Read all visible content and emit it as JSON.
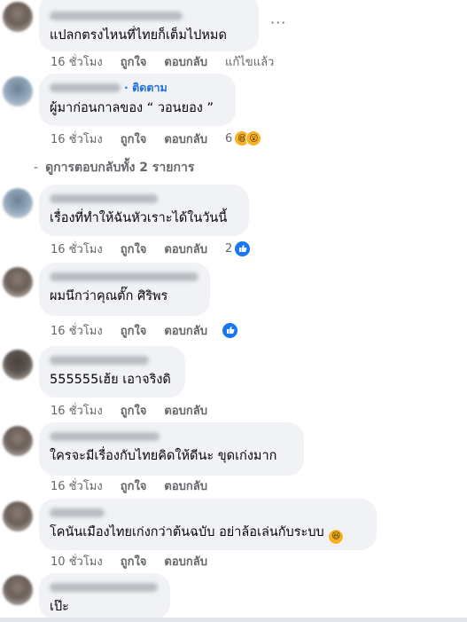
{
  "comments": [
    {
      "text": "แปลกตรงไหนที่ไทยก็เต็มไปหมด",
      "time": "16 ชั่วโมง",
      "like": "ถูกใจ",
      "reply": "ตอบกลับ",
      "edited": "แก้ไขแล้ว"
    },
    {
      "follow": "ติดตาม",
      "text": "ผู้มาก่อนกาลของ “ วอนยอง ”",
      "time": "16 ชั่วโมง",
      "like": "ถูกใจ",
      "reply": "ตอบกลับ",
      "reaction_count": "6"
    },
    {
      "text": "เรื่องที่ทำให้ฉันหัวเราะได้ในวันนี้",
      "time": "16 ชั่วโมง",
      "like": "ถูกใจ",
      "reply": "ตอบกลับ",
      "reaction_count": "2"
    },
    {
      "text": "ผมนึกว่าคุณตั๊ก ศิริพร",
      "time": "16 ชั่วโมง",
      "like": "ถูกใจ",
      "reply": "ตอบกลับ"
    },
    {
      "text": "555555เฮ้ย เอาจริงดิ",
      "time": "16 ชั่วโมง",
      "like": "ถูกใจ",
      "reply": "ตอบกลับ"
    },
    {
      "text": "ใครจะมีเรื่องกับไทยคิดให้ดีนะ ขุดเก่งมาก",
      "time": "16 ชั่วโมง",
      "like": "ถูกใจ",
      "reply": "ตอบกลับ"
    },
    {
      "text": "โคนันเมืองไทยเก่งกว่าต้นฉบับ อย่าล้อเล่นกับระบบ",
      "time": "10 ชั่วโมง",
      "like": "ถูกใจ",
      "reply": "ตอบกลับ"
    },
    {
      "text": "เป๊ะ"
    }
  ],
  "view_replies": "ดูการตอบกลับทั้ง 2 รายการ",
  "icons": {
    "more": "more-dots-icon",
    "laugh": "laugh-emoji",
    "wow": "wow-emoji",
    "like": "like-thumb-icon"
  },
  "colors": {
    "bubble": "#f0f2f5",
    "link": "#216fdb",
    "meta": "#65676b",
    "like_blue": "#1877f2"
  }
}
